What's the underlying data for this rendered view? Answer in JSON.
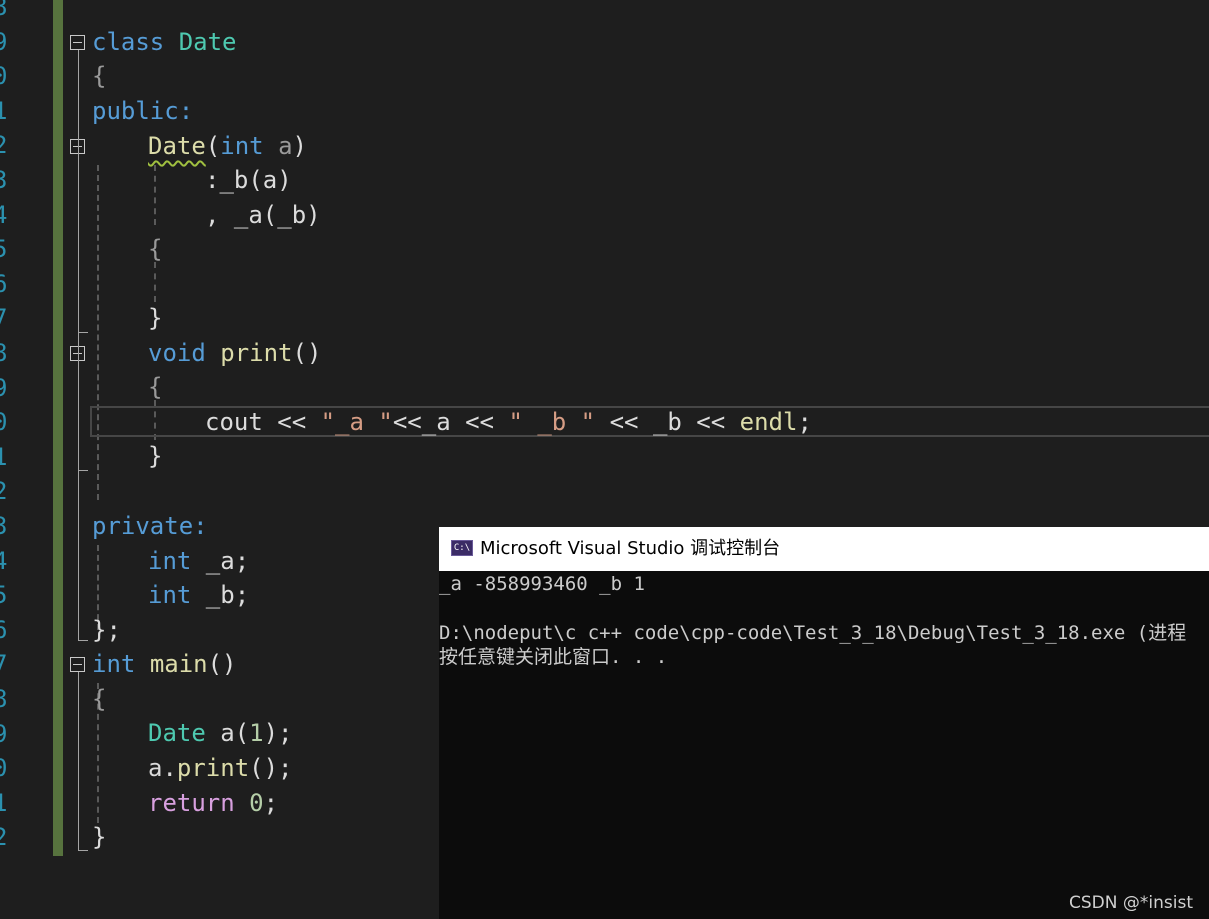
{
  "editor": {
    "line_numbers": [
      "8",
      "9",
      "0",
      "1",
      "2",
      "3",
      "4",
      "5",
      "6",
      "7",
      "8",
      "9",
      "0",
      "1",
      "2",
      "3",
      "4",
      "5",
      "6",
      "7",
      "8",
      "9",
      "0",
      "1",
      "2"
    ],
    "code": {
      "l1_kw": "class",
      "l1_ty": "Date",
      "l2": "{",
      "l3": "public:",
      "l4_fn": "Date",
      "l4_paren": "(",
      "l4_kw": "int",
      "l4_pm": "a",
      "l4_close": ")",
      "l5": ":_b(a)",
      "l6": ", _a(_b)",
      "l7": "{",
      "l9": "}",
      "l10_kw": "void",
      "l10_fn": "print",
      "l10_paren": "()",
      "l11": "{",
      "l12_a": "cout << ",
      "l12_s1": "\"_a \"",
      "l12_b": "<<_a << ",
      "l12_s2": "\" _b \"",
      "l12_c": " << _b << ",
      "l12_d": "endl",
      "l12_e": ";",
      "l13": "}",
      "l15": "private:",
      "l16_kw": "int",
      "l16_rest": " _a;",
      "l17_kw": "int",
      "l17_rest": " _b;",
      "l18": "};",
      "l19_kw": "int",
      "l19_fn": "main",
      "l19_rest": "()",
      "l20": "{",
      "l21_ty": "Date",
      "l21_id": " a",
      "l21_rest": "(",
      "l21_num": "1",
      "l21_end": ");",
      "l22_id": "a",
      "l22_dot": ".",
      "l22_fn": "print",
      "l22_end": "();",
      "l23_kw": "return",
      "l23_num": "0",
      "l23_end": ";",
      "l24": "}"
    }
  },
  "console": {
    "title": "Microsoft Visual Studio 调试控制台",
    "icon_text": "C:\\",
    "icon_name": "console-app-icon",
    "output_line": "_a -858993460 _b 1",
    "path_line": "D:\\nodeput\\c c++ code\\cpp-code\\Test_3_18\\Debug\\Test_3_18.exe (进程",
    "prompt_line": "按任意键关闭此窗口. . ."
  },
  "watermark": "CSDN @*insist",
  "colors": {
    "editor_bg": "#1e1e1e",
    "keyword": "#569cd6",
    "type": "#4ec9b0",
    "function": "#dcdcaa",
    "string": "#d69d85",
    "number": "#b5cea8",
    "control": "#d8a0df",
    "line_number": "#2b91af",
    "change_bar": "#57733e"
  }
}
